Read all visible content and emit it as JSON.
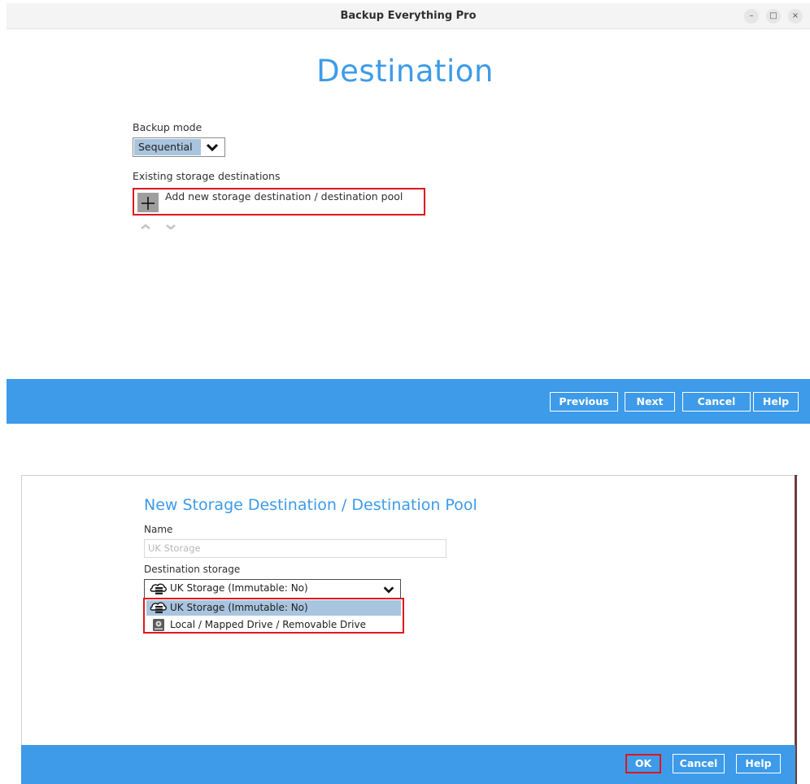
{
  "window1": {
    "title": "Backup Everything Pro",
    "controls": {
      "minimize": "–",
      "maximize": "□",
      "close": "×"
    },
    "page_title": "Destination",
    "backup_mode": {
      "label": "Backup mode",
      "selected": "Sequential"
    },
    "existing_label": "Existing storage destinations",
    "add_destination": "Add new storage destination / destination pool",
    "footer": {
      "previous": "Previous",
      "next": "Next",
      "cancel": "Cancel",
      "help": "Help"
    }
  },
  "window2": {
    "title": "New Storage Destination / Destination Pool",
    "name_label": "Name",
    "name_value": "UK Storage",
    "dest_label": "Destination storage",
    "dest_selected": "UK Storage (Immutable: No)",
    "options": [
      {
        "label": "UK Storage (Immutable: No)",
        "icon": "cloud-storage-icon"
      },
      {
        "label": "Local / Mapped Drive / Removable Drive",
        "icon": "drive-icon"
      }
    ],
    "footer": {
      "ok": "OK",
      "cancel": "Cancel",
      "help": "Help"
    }
  },
  "colors": {
    "accent": "#3d9be9",
    "highlight_border": "#e0161c",
    "selected_option": "#a9c4de"
  }
}
